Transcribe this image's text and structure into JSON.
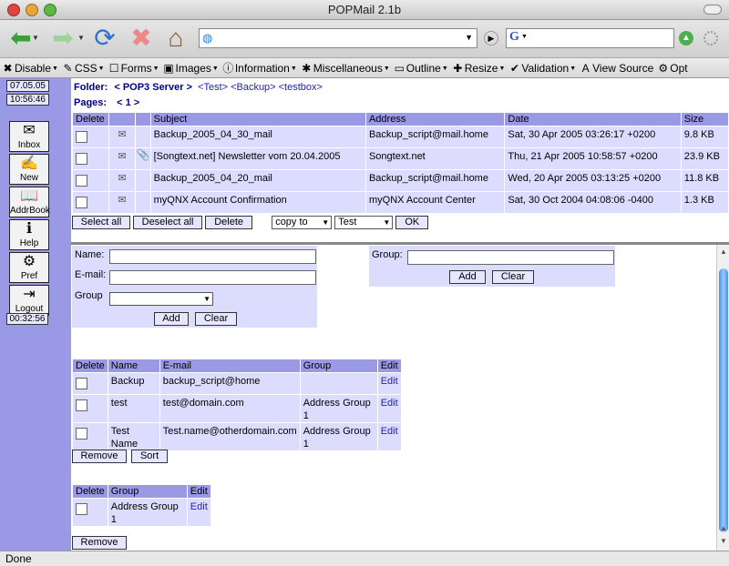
{
  "window": {
    "title": "POPMail 2.1b"
  },
  "devbar": [
    {
      "icon": "✖",
      "label": "Disable"
    },
    {
      "icon": "✎",
      "label": "CSS"
    },
    {
      "icon": "☐",
      "label": "Forms"
    },
    {
      "icon": "▣",
      "label": "Images"
    },
    {
      "icon": "ⓘ",
      "label": "Information"
    },
    {
      "icon": "✱",
      "label": "Miscellaneous"
    },
    {
      "icon": "▭",
      "label": "Outline"
    },
    {
      "icon": "✚",
      "label": "Resize"
    },
    {
      "icon": "✔",
      "label": "Validation"
    },
    {
      "icon": "A",
      "label": "View Source"
    },
    {
      "icon": "⚙",
      "label": "Opt"
    }
  ],
  "sidebar": {
    "date": "07.05.05",
    "time": "10:56:46",
    "buttons": [
      {
        "label": "Inbox",
        "icon": "✉"
      },
      {
        "label": "New",
        "icon": "✍"
      },
      {
        "label": "AddrBook",
        "icon": "📖"
      },
      {
        "label": "Help",
        "icon": "ℹ"
      },
      {
        "label": "Pref",
        "icon": "⚙"
      },
      {
        "label": "Logout",
        "icon": "⇥"
      }
    ],
    "timer": "00:32:56"
  },
  "top": {
    "folder_label": "Folder:",
    "folder_root": "< POP3 Server >",
    "folder_path": [
      "<Test>",
      "<Backup>",
      "<testbox>"
    ],
    "pages_label": "Pages:",
    "pages_value": "< 1 >",
    "columns": [
      "Delete",
      "",
      "",
      "Subject",
      "Address",
      "Date",
      "Size"
    ],
    "rows": [
      {
        "subject": "Backup_2005_04_30_mail",
        "address": "Backup_script@mail.home",
        "date": "Sat, 30 Apr 2005 03:26:17 +0200",
        "size": "9.8 KB",
        "attach": false
      },
      {
        "subject": "[Songtext.net] Newsletter vom 20.04.2005",
        "address": "Songtext.net",
        "date": "Thu, 21 Apr 2005 10:58:57 +0200",
        "size": "23.9 KB",
        "attach": true
      },
      {
        "subject": "Backup_2005_04_20_mail",
        "address": "Backup_script@mail.home",
        "date": "Wed, 20 Apr 2005 03:13:25 +0200",
        "size": "11.8 KB",
        "attach": false
      },
      {
        "subject": "myQNX Account Confirmation",
        "address": "myQNX Account Center",
        "date": "Sat, 30 Oct 2004 04:08:06 -0400",
        "size": "1.3 KB",
        "attach": false
      }
    ],
    "select_all": "Select all",
    "deselect_all": "Deselect all",
    "delete": "Delete",
    "copy_to": "copy to",
    "target": "Test",
    "ok": "OK"
  },
  "contact_form": {
    "name_label": "Name:",
    "email_label": "E-mail:",
    "group_label": "Group",
    "add": "Add",
    "clear": "Clear"
  },
  "group_form": {
    "group_label": "Group:",
    "add": "Add",
    "clear": "Clear"
  },
  "contacts": {
    "columns": [
      "Delete",
      "Name",
      "E-mail",
      "Group",
      "Edit"
    ],
    "rows": [
      {
        "name": "Backup",
        "email": "backup_script@home",
        "group": "",
        "edit": "Edit"
      },
      {
        "name": "test",
        "email": "test@domain.com",
        "group": "Address Group 1",
        "edit": "Edit"
      },
      {
        "name": "Test Name",
        "email": "Test.name@otherdomain.com",
        "group": "Address Group 1",
        "edit": "Edit"
      }
    ],
    "remove": "Remove",
    "sort": "Sort"
  },
  "groups": {
    "columns": [
      "Delete",
      "Group",
      "Edit"
    ],
    "rows": [
      {
        "group": "Address Group 1",
        "edit": "Edit"
      }
    ],
    "remove": "Remove"
  },
  "status": {
    "text": "Done"
  }
}
